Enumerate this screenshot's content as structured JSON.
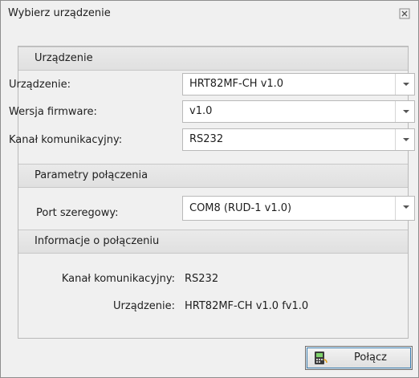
{
  "window": {
    "title": "Wybierz urządzenie"
  },
  "device_section": {
    "header": "Urządzenie",
    "device_label": "Urządzenie:",
    "device_value": "HRT82MF-CH v1.0",
    "firmware_label": "Wersja firmware:",
    "firmware_value": "v1.0",
    "channel_label": "Kanał komunikacyjny:",
    "channel_value": "RS232"
  },
  "connection_section": {
    "header": "Parametry połączenia",
    "port_label": "Port szeregowy:",
    "port_value": "COM8 (RUD-1 v1.0)"
  },
  "info_section": {
    "header": "Informacje o połączeniu",
    "channel_label": "Kanał komunikacyjny:",
    "channel_value": "RS232",
    "device_label": "Urządzenie:",
    "device_value": "HRT82MF-CH v1.0 fv1.0"
  },
  "footer": {
    "connect_label": "Połącz"
  }
}
